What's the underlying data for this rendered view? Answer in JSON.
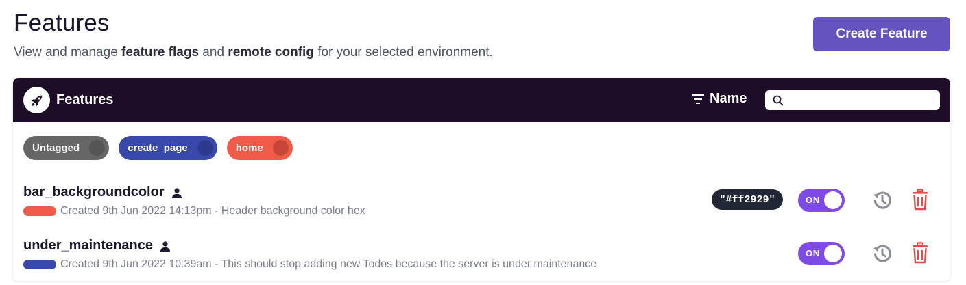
{
  "header": {
    "title": "Features",
    "description": {
      "part1": "View and manage ",
      "bold1": "feature flags",
      "part2": " and ",
      "bold2": "remote config",
      "part3": " for your selected environment."
    },
    "create_button_label": "Create Feature"
  },
  "panel": {
    "title": "Features",
    "rocket_icon": "rocket-icon",
    "sort_label": "Name",
    "sort_icon": "filter-lines-icon",
    "search": {
      "placeholder": "",
      "value": ""
    }
  },
  "tags": [
    {
      "label": "Untagged",
      "color": "#666666",
      "dot_color": "#555555"
    },
    {
      "label": "create_page",
      "color": "#3949ab",
      "dot_color": "#2c3a8f"
    },
    {
      "label": "home",
      "color": "#ef5b48",
      "dot_color": "#c84637"
    }
  ],
  "features": [
    {
      "name": "bar_backgroundcolor",
      "owner_icon": "user-icon",
      "tag_color": "#ef5b48",
      "meta": "Created 9th Jun 2022 14:13pm - Header background color hex",
      "value": "\"#ff2929\"",
      "toggle_label": "ON",
      "enabled": true
    },
    {
      "name": "under_maintenance",
      "owner_icon": "user-icon",
      "tag_color": "#3949ab",
      "meta": "Created 9th Jun 2022 10:39am - This should stop adding new Todos because the server is under maintenance",
      "value": null,
      "toggle_label": "ON",
      "enabled": true
    }
  ],
  "colors": {
    "accent": "#6554c0",
    "header_bg": "#1e0d26",
    "toggle_on": "#7f4be6",
    "delete": "#e24c4b",
    "history": "#8a8f96"
  }
}
